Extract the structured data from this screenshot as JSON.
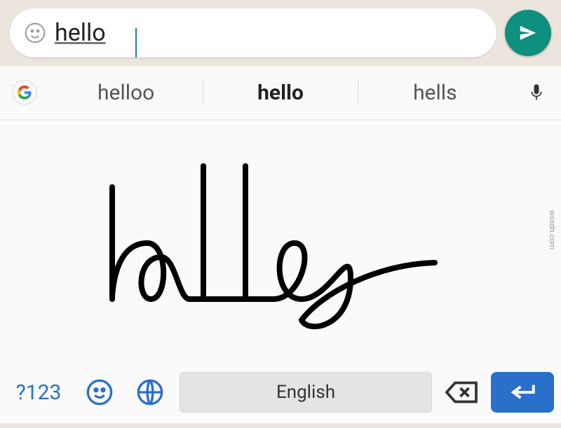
{
  "chat": {
    "input_value": "hello"
  },
  "keyboard": {
    "suggestions": [
      "helloo",
      "hello",
      "hells"
    ],
    "selected_suggestion_index": 1,
    "symbols_key": "?123",
    "space_label": "English"
  },
  "icons": {
    "emoji": "emoji-icon",
    "send": "send-icon",
    "google": "google-icon",
    "mic": "mic-icon",
    "globe": "globe-icon",
    "backspace": "backspace-icon",
    "enter": "enter-icon"
  },
  "watermark": "wsxdn.com"
}
